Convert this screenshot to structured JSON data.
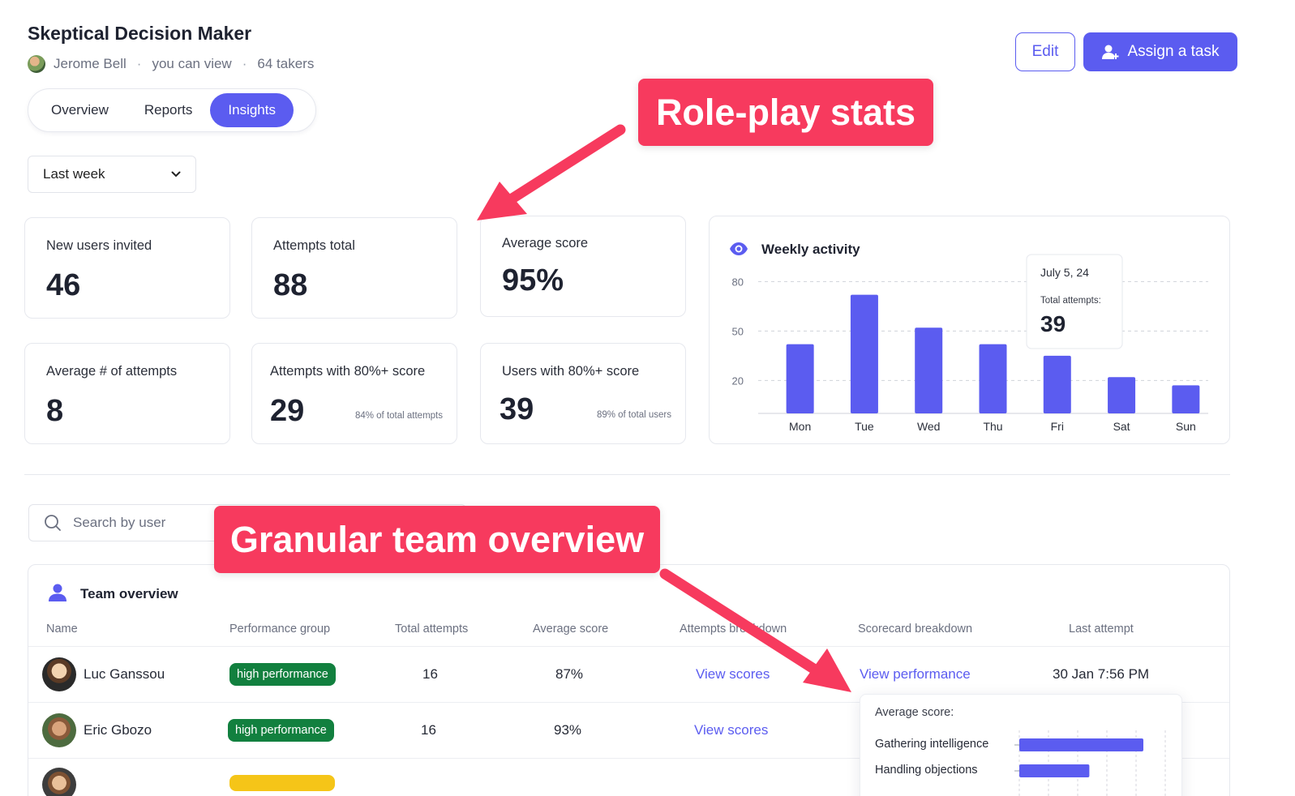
{
  "header": {
    "title": "Skeptical Decision Maker",
    "author": "Jerome Bell",
    "permission": "you can view",
    "takers": "64 takers",
    "edit_label": "Edit",
    "assign_label": "Assign a task"
  },
  "tabs": [
    {
      "label": "Overview",
      "active": false
    },
    {
      "label": "Reports",
      "active": false
    },
    {
      "label": "Insights",
      "active": true
    }
  ],
  "filter": {
    "selected": "Last week"
  },
  "stats": [
    {
      "label": "New users invited",
      "value": "46",
      "sub": ""
    },
    {
      "label": "Attempts total",
      "value": "88",
      "sub": ""
    },
    {
      "label": "Average score",
      "value": "95%",
      "sub": ""
    },
    {
      "label": "Average # of attempts",
      "value": "8",
      "sub": ""
    },
    {
      "label": "Attempts with 80%+ score",
      "value": "29",
      "sub": "84% of total attempts"
    },
    {
      "label": "Users with 80%+ score",
      "value": "39",
      "sub": "89% of total users"
    }
  ],
  "chart_title": "Weekly activity",
  "chart_data": {
    "type": "bar",
    "title": "Weekly activity",
    "categories": [
      "Mon",
      "Tue",
      "Wed",
      "Thu",
      "Fri",
      "Sat",
      "Sun"
    ],
    "values": [
      42,
      72,
      52,
      42,
      35,
      22,
      17
    ],
    "yticks": [
      20,
      50,
      80
    ],
    "ylim": [
      0,
      90
    ],
    "grid": true,
    "bar_color": "#5b5cf0",
    "tooltip": {
      "date": "July 5, 24",
      "label": "Total attempts:",
      "value": "39"
    }
  },
  "search": {
    "placeholder": "Search by user"
  },
  "team": {
    "title": "Team overview",
    "columns": [
      "Name",
      "Performance group",
      "Total attempts",
      "Average score",
      "Attempts breakdown",
      "Scorecard breakdown",
      "Last attempt"
    ],
    "rows": [
      {
        "name": "Luc Ganssou",
        "group": "high performance",
        "attempts": "16",
        "score": "87%",
        "breakdown": "View scores",
        "scorecard": "View performance",
        "last": "30 Jan 7:56 PM"
      },
      {
        "name": "Eric Gbozo",
        "group": "high performance",
        "attempts": "16",
        "score": "93%",
        "breakdown": "View scores",
        "scorecard": "",
        "last": ""
      }
    ]
  },
  "popover": {
    "title": "Average score:",
    "items": [
      {
        "label": "Gathering intelligence",
        "value": 0.85
      },
      {
        "label": "Handling objections",
        "value": 0.48
      }
    ]
  },
  "callouts": {
    "stats": "Role-play stats",
    "team": "Granular team overview"
  },
  "colors": {
    "accent": "#5b5cf0",
    "callout": "#f73a5e",
    "badge_green": "#12803f",
    "badge_yellow": "#f5c518"
  }
}
